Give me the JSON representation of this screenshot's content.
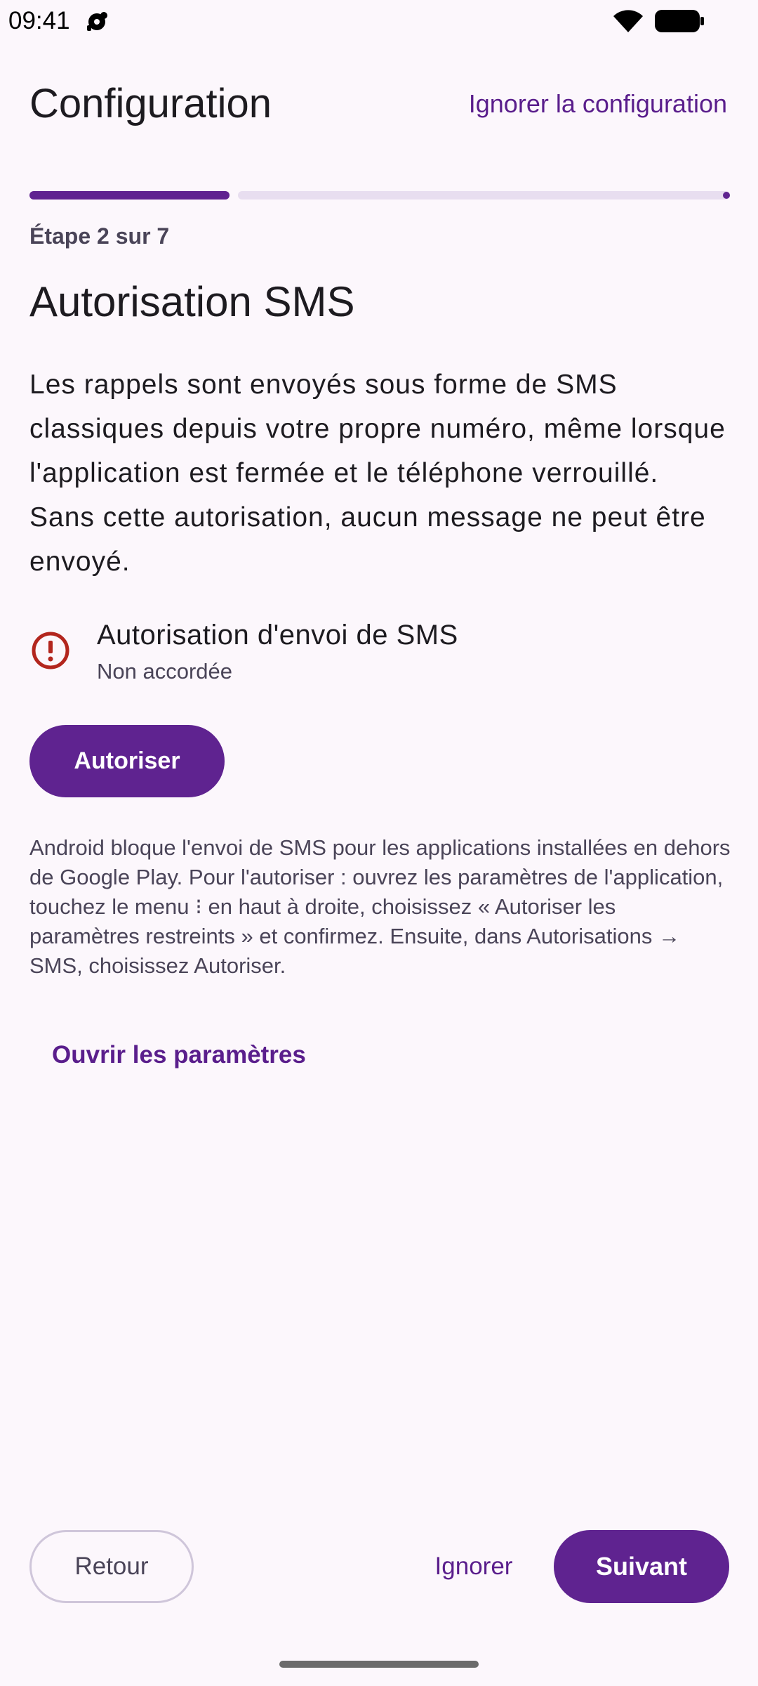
{
  "status_bar": {
    "time": "09:41",
    "icons": [
      "app-notification-icon",
      "wifi-icon",
      "battery-icon"
    ]
  },
  "header": {
    "title": "Configuration",
    "skip_label": "Ignorer la configuration"
  },
  "progress": {
    "step_label": "Étape 2 sur 7",
    "current_step": 2,
    "total_steps": 7,
    "fraction": 0.2857
  },
  "section": {
    "title": "Autorisation SMS",
    "description": "Les rappels sont envoyés sous forme de SMS classiques depuis votre propre numéro, même lorsque l'application est fermée et le téléphone verrouillé. Sans cette autorisation, aucun message ne peut être envoyé."
  },
  "permission": {
    "icon": "error-icon",
    "title": "Autorisation d'envoi de SMS",
    "status": "Non accordée",
    "authorize_label": "Autoriser"
  },
  "help": {
    "text": "Android bloque l'envoi de SMS pour les applications installées en dehors de Google Play. Pour l'autoriser : ouvrez les paramètres de l'application, touchez le menu ⁝ en haut à droite, choisissez « Autoriser les paramètres restreints » et confirmez. Ensuite, dans Autorisations → SMS, choisissez Autoriser.",
    "open_settings_label": "Ouvrir les paramètres"
  },
  "footer": {
    "back_label": "Retour",
    "ignore_label": "Ignorer",
    "next_label": "Suivant"
  },
  "colors": {
    "background": "#FCF7FC",
    "primary": "#5F2390",
    "error": "#B3261E",
    "progress_track": "#E8DEF0"
  }
}
